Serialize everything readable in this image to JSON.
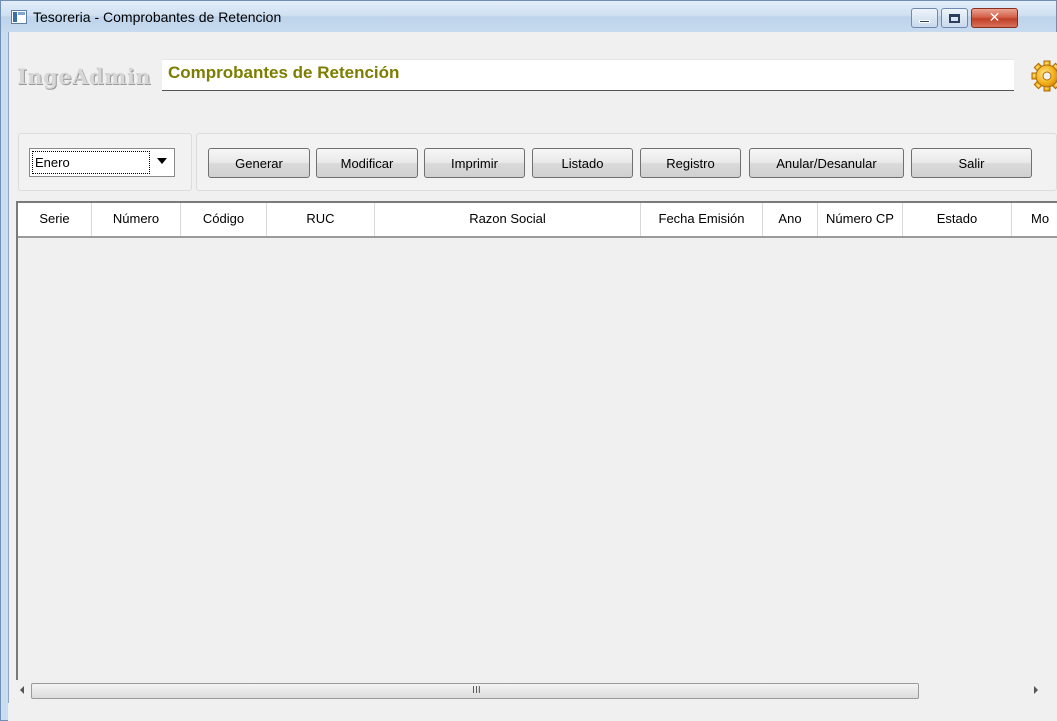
{
  "window": {
    "title": "Tesoreria - Comprobantes de Retencion"
  },
  "header": {
    "brand": "IngeAdmin",
    "title": "Comprobantes de Retención"
  },
  "filter": {
    "month_selected": "Enero"
  },
  "toolbar": {
    "generar": "Generar",
    "modificar": "Modificar",
    "imprimir": "Imprimir",
    "listado": "Listado",
    "registro": "Registro",
    "anular": "Anular/Desanular",
    "salir": "Salir"
  },
  "grid": {
    "columns": [
      "Serie",
      "Número",
      "Código",
      "RUC",
      "Razon Social",
      "Fecha Emisión",
      "Ano",
      "Número CP",
      "Estado",
      "Mo"
    ],
    "rows": []
  },
  "scrollbar": {
    "grip": "III"
  },
  "colors": {
    "header_title": "#7d7d00",
    "brand": "#d7d7d7",
    "close_button": "#c13f27"
  }
}
